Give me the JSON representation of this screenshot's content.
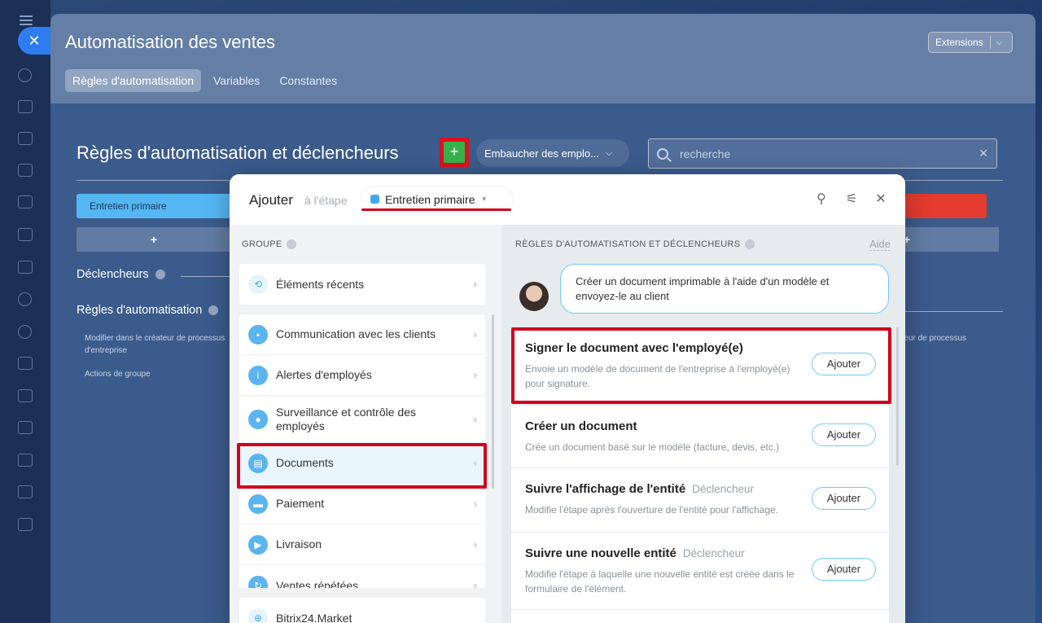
{
  "page": {
    "title": "Automatisation des ventes",
    "extensions_label": "Extensions",
    "tabs": [
      "Règles d'automatisation",
      "Variables",
      "Constantes"
    ]
  },
  "rules_section": {
    "title": "Règles d'automatisation et déclencheurs",
    "add_symbol": "+",
    "pipeline_label": "Embaucher des emplo...",
    "search_placeholder": "recherche",
    "stage_label": "Entretien primaire",
    "triggers_label": "Déclencheurs",
    "rules_label": "Règles d'automatisation",
    "left_note_1": "Modifier dans le créateur de processus d'entreprise",
    "left_note_2": "Actions de groupe",
    "right_note": "ateur de processus"
  },
  "popup": {
    "title": "Ajouter",
    "subtitle": "à l'étape",
    "stage": "Entretien primaire",
    "group_header": "GROUPE",
    "rules_header": "RÈGLES D'AUTOMATISATION ET DÉCLENCHEURS",
    "help_link": "Aide",
    "groups": [
      {
        "label": "Éléments récents",
        "icon": "history-icon"
      },
      {
        "label": "Communication avec les clients",
        "icon": "chat-icon"
      },
      {
        "label": "Alertes d'employés",
        "icon": "info-icon"
      },
      {
        "label": "Surveillance et contrôle des employés",
        "icon": "users-icon"
      },
      {
        "label": "Documents",
        "icon": "document-icon"
      },
      {
        "label": "Paiement",
        "icon": "wallet-icon"
      },
      {
        "label": "Livraison",
        "icon": "truck-icon"
      },
      {
        "label": "Ventes répétées",
        "icon": "repeat-icon"
      },
      {
        "label": "Bitrix24.Market",
        "icon": "market-icon"
      }
    ],
    "bubble_text": "Créer un document imprimable à l'aide d'un modèle et envoyez-le au client",
    "rules": [
      {
        "title": "Signer le document avec l'employé(e)",
        "tag": "",
        "desc": "Envoie un modèle de document de l'entreprise à l'employé(e) pour signature.",
        "button": "Ajouter"
      },
      {
        "title": "Créer un document",
        "tag": "",
        "desc": "Crée un document basé sur le modèle (facture, devis, etc.)",
        "button": "Ajouter"
      },
      {
        "title": "Suivre l'affichage de l'entité",
        "tag": "Déclencheur",
        "desc": "Modifie l'étape après l'ouverture de l'entité pour l'affichage.",
        "button": "Ajouter"
      },
      {
        "title": "Suivre une nouvelle entité",
        "tag": "Déclencheur",
        "desc": "Modifie l'étape à laquelle une nouvelle entité est créée dans le formulaire de l'élément.",
        "button": "Ajouter"
      }
    ]
  },
  "colors": {
    "accent_blue": "#3fa9f5",
    "highlight_red": "#d0021b",
    "add_green": "#35b24b",
    "stage_blue": "#54b6f2",
    "stage_red": "#e33b2e"
  }
}
